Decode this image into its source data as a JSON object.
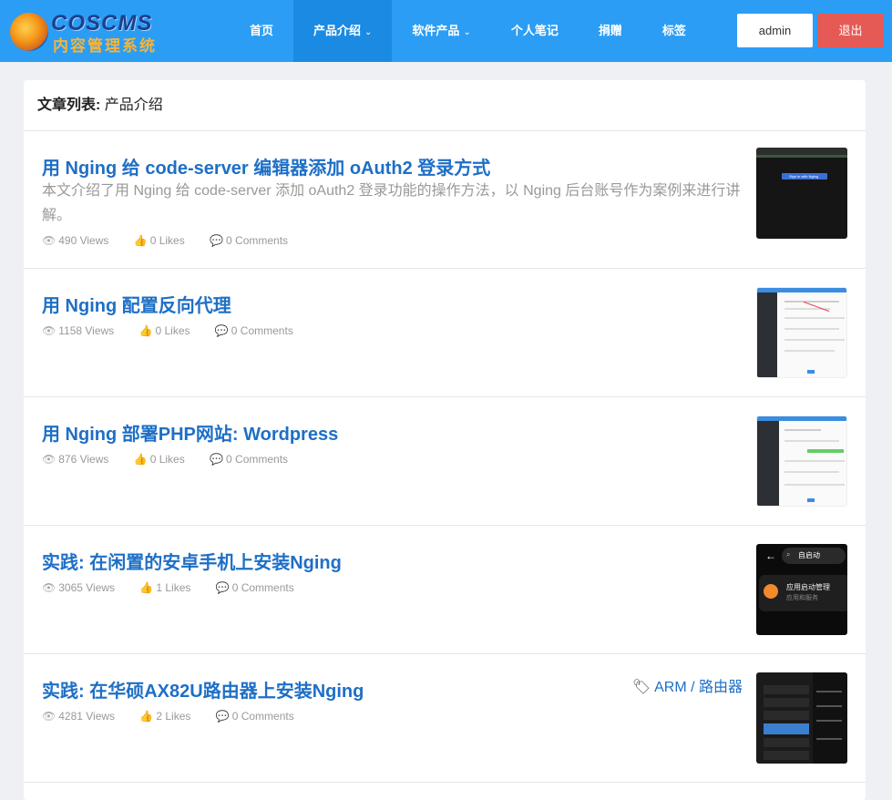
{
  "brand": {
    "name": "COSCMS",
    "subtitle": "内容管理系统"
  },
  "nav": [
    {
      "label": "首页",
      "caret": ""
    },
    {
      "label": "产品介绍",
      "caret": "⌄",
      "active": true
    },
    {
      "label": "软件产品",
      "caret": "⌄"
    },
    {
      "label": "个人笔记",
      "caret": ""
    },
    {
      "label": "捐赠",
      "caret": ""
    },
    {
      "label": "标签",
      "caret": ""
    }
  ],
  "user": {
    "admin_label": "admin",
    "logout_label": "退出"
  },
  "list": {
    "heading_label": "文章列表:",
    "heading_value": "产品介绍"
  },
  "articles": [
    {
      "title": "用 Nging 给 code-server 编辑器添加 oAuth2 登录方式",
      "summary": "本文介绍了用 Nging 给 code-server 添加 oAuth2 登录功能的操作方法，以 Nging 后台账号作为案例来进行讲解。",
      "views": "490 Views",
      "likes": "0 Likes",
      "comments": "0 Comments",
      "thumb_text": "Sign in with Nging"
    },
    {
      "title": "用 Nging 配置反向代理",
      "summary": "",
      "views": "1158 Views",
      "likes": "0 Likes",
      "comments": "0 Comments"
    },
    {
      "title": "用 Nging 部署PHP网站: Wordpress",
      "summary": "",
      "views": "876 Views",
      "likes": "0 Likes",
      "comments": "0 Comments"
    },
    {
      "title": "实践: 在闲置的安卓手机上安装Nging",
      "summary": "",
      "views": "3065 Views",
      "likes": "1 Likes",
      "comments": "0 Comments",
      "thumb_search": "自启动",
      "thumb_item": "应用启动管理",
      "thumb_item_sub": "应用和服务"
    },
    {
      "title": "实践: 在华硕AX82U路由器上安装Nging",
      "summary": "",
      "views": "4281 Views",
      "likes": "2 Likes",
      "comments": "0 Comments",
      "tags": "ARM / 路由器"
    }
  ],
  "icons": {
    "views": "eye-icon",
    "likes": "thumbs-up-icon",
    "comments": "comment-icon",
    "tags": "tags-icon"
  },
  "colors": {
    "navbar": "#2b9df4",
    "link": "#1e6fc6",
    "logout": "#e55a55",
    "muted": "#999999"
  }
}
